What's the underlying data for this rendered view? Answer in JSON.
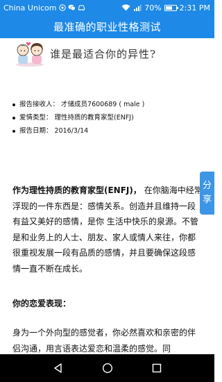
{
  "status_bar": {
    "carrier": "China Unicom",
    "battery": "70%",
    "battery_level": 0.7,
    "time": "2:31 PM"
  },
  "title_bar": {
    "title": "最准确的职业性格测试"
  },
  "banner": {
    "text": "谁是最适合你的异性?"
  },
  "report_info": {
    "recipient": "报告接收人： 才储成员7600689 ( male )",
    "type": "爱情类型： 理性持质的教育家型(ENFJ)",
    "date": "报告日期： 2016/3/14"
  },
  "share_tab": {
    "char1": "分",
    "char2": "享"
  },
  "article": {
    "para1_bold": "作为理性持质的教育家型(ENFJ)，",
    "para1_rest": " 在你脑海中经常浮现的一件东西是：感情关系。创造并且维持一段有益又美好的感情，是你 生活中快乐的泉源。不管是和业务上的人士、朋友、家人或情人来往，你都很重视发展一段有品质的感情，并且要确保这段感情一直不断在成长。",
    "heading2": "你的恋爱表现：",
    "para2": "身为一个外向型的感觉者，你必然喜欢和亲密的伴侣沟通，用言语表达爱恋和温柔的感觉。同"
  },
  "colors": {
    "accent": "#1e89e6",
    "share_tab": "#3d95e6",
    "nav_bar": "#000000"
  },
  "icons": {
    "status_left": [
      "sim-icon",
      "wechat-icon",
      "car-icon"
    ],
    "status_right": [
      "wifi-icon",
      "signal-icon",
      "battery-icon"
    ],
    "nav": [
      "back-icon",
      "home-icon",
      "recents-icon"
    ]
  }
}
